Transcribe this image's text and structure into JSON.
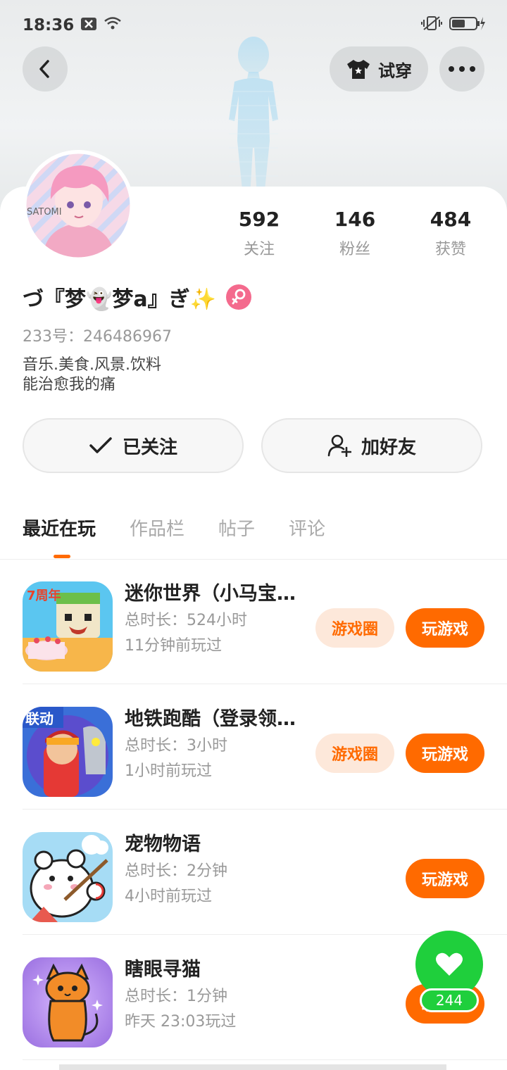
{
  "status_bar": {
    "time": "18:36"
  },
  "header": {
    "try_on_label": "试穿"
  },
  "profile": {
    "nickname": "づ『梦👻梦a』ぎ✨",
    "uid": "233号：246486967",
    "bio_lines": [
      "音乐.美食.风景.饮料",
      "能治愈我的痛"
    ],
    "avatar_text": "SATOMI"
  },
  "stats": [
    {
      "value": "592",
      "label": "关注"
    },
    {
      "value": "146",
      "label": "粉丝"
    },
    {
      "value": "484",
      "label": "获赞"
    }
  ],
  "actions": {
    "followed_label": "已关注",
    "add_friend_label": "加好友"
  },
  "tabs": [
    "最近在玩",
    "作品栏",
    "帖子",
    "评论"
  ],
  "games": [
    {
      "title": "迷你世界（小马宝莉）",
      "duration": "总时长：524小时",
      "last_played": "11分钟前玩过",
      "circle_label": "游戏圈",
      "play_label": "玩游戏",
      "badge": "7周年"
    },
    {
      "title": "地铁跑酷（登录领取）",
      "duration": "总时长：3小时",
      "last_played": "1小时前玩过",
      "circle_label": "游戏圈",
      "play_label": "玩游戏",
      "badge": "联动"
    },
    {
      "title": "宠物物语",
      "duration": "总时长：2分钟",
      "last_played": "4小时前玩过",
      "play_label": "玩游戏"
    },
    {
      "title": "瞎眼寻猫",
      "duration": "总时长：1分钟",
      "last_played": "昨天 23:03玩过",
      "play_label": "玩游戏"
    }
  ],
  "like_widget": {
    "count": "244"
  },
  "colors": {
    "accent": "#ff6a00",
    "like_green": "#1fcf3c",
    "gender": "#f46a8d"
  }
}
